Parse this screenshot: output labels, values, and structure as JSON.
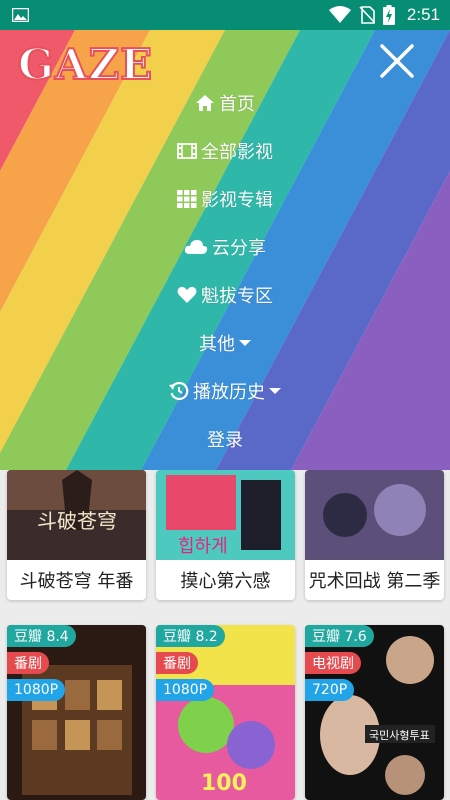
{
  "statusbar": {
    "time": "2:51"
  },
  "app": {
    "logo": "GAZE"
  },
  "menu": {
    "items": [
      {
        "label": "首页",
        "icon": "home-icon"
      },
      {
        "label": "全部影视",
        "icon": "film-icon"
      },
      {
        "label": "影视专辑",
        "icon": "grid-icon"
      },
      {
        "label": "云分享",
        "icon": "cloud-icon"
      },
      {
        "label": "魁拔专区",
        "icon": "heart-icon"
      },
      {
        "label": "其他",
        "icon": "caret-down-icon"
      },
      {
        "label": "播放历史",
        "icon": "history-icon"
      },
      {
        "label": "登录",
        "icon": ""
      }
    ]
  },
  "cards_row1": [
    {
      "title": "斗破苍穹 年番"
    },
    {
      "title": "摸心第六感"
    },
    {
      "title": "咒术回战 第二季"
    }
  ],
  "cards_row2": [
    {
      "score": "豆瓣 8.4",
      "genre": "番剧",
      "res": "1080P"
    },
    {
      "score": "豆瓣 8.2",
      "genre": "番剧",
      "res": "1080P"
    },
    {
      "score": "豆瓣 7.6",
      "genre": "电视剧",
      "res": "720P"
    }
  ],
  "colors": {
    "statusbar": "#068d73",
    "rainbow": [
      "#f0596a",
      "#f6a34a",
      "#f3d04c",
      "#8fc95a",
      "#2fb8a9",
      "#3a8fd8",
      "#5a69c8",
      "#8a5fc0"
    ]
  }
}
